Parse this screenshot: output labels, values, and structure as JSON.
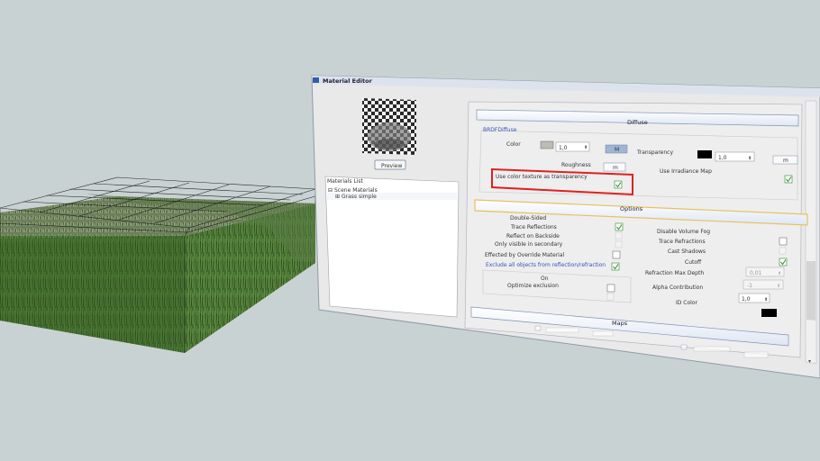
{
  "window": {
    "title": "Material Editor"
  },
  "preview": {
    "button_label": "Preview"
  },
  "materials": {
    "list_label": "Materials List",
    "tree": [
      {
        "expander": "⊟",
        "label": "Scene Materials"
      },
      {
        "expander": "⊞",
        "label": "Grass simple"
      }
    ]
  },
  "diffuse": {
    "section_title": "Diffuse",
    "group_title": "BRDFDiffuse",
    "color_label": "Color",
    "color_value": "1,0",
    "color_map_button": "M",
    "transparency_label": "Transparency",
    "transparency_value": "1,0",
    "transparency_map_button": "m",
    "roughness_label": "Roughness",
    "roughness_map_button": "m",
    "irradiance_label": "Use Irradiance Map",
    "irradiance_checked": true,
    "color_texture_label": "Use color texture as transparency",
    "color_texture_checked": true,
    "swatch_color": "#bcbcb4",
    "transparency_swatch": "#000000"
  },
  "options": {
    "section_title": "Options",
    "left": [
      {
        "label": "Double-Sided",
        "checked": null
      },
      {
        "label": "Trace Reflections",
        "checked": true
      },
      {
        "label": "Reflect on Backside",
        "checked": false,
        "disabled": true
      },
      {
        "label": "Only visible in secondary",
        "checked": false,
        "disabled": true
      },
      {
        "label": "Effected by Override Material",
        "checked": false
      },
      {
        "label": "Exclude all objects from reflection/refraction",
        "checked": true
      }
    ],
    "exclusion_on_label": "On",
    "optimize_exclusion_label": "Optimize exclusion",
    "right": [
      {
        "label": "Disable Volume Fog",
        "checked": null
      },
      {
        "label": "Trace Refractions",
        "checked": false
      },
      {
        "label": "Cast Shadows",
        "checked": false,
        "disabled": true
      },
      {
        "label": "Cutoff",
        "checked": true
      }
    ],
    "refraction_max_depth_label": "Refraction Max Depth",
    "refraction_max_depth_value": "0,01",
    "alpha_contribution_label": "Alpha Contribution",
    "alpha_contribution_value": "-1",
    "id_color_label": "ID Color",
    "id_color_value": "1,0",
    "id_color_swatch": "#000000"
  },
  "maps": {
    "section_title": "Maps"
  },
  "colors": {
    "highlight": "#e02020",
    "section_border": "#e8c060",
    "check": "#2a8a2a"
  }
}
